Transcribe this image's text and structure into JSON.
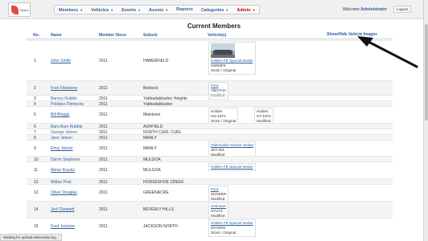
{
  "logo_text": "Demo",
  "nav": [
    {
      "label": "Members",
      "caret": true
    },
    {
      "label": "Vehicles",
      "caret": true
    },
    {
      "label": "Events",
      "caret": true
    },
    {
      "label": "Assets",
      "caret": true
    },
    {
      "label": "Reports",
      "caret": false
    },
    {
      "label": "Categories",
      "caret": true
    },
    {
      "label": "Admin",
      "caret": true,
      "highlight": true
    }
  ],
  "welcome_text": "Welcome",
  "welcome_user": "Administrator",
  "logout_label": "Logout",
  "page_title": "Current Members",
  "toggle_images_label": "Show/Hide Vehicle Images",
  "columns": {
    "no": "No.",
    "name": "Name",
    "since": "Member Since",
    "suburb": "Suburb",
    "vehicles": "Vehicle(s)"
  },
  "members": [
    {
      "no": "1",
      "name": "John Smith",
      "since": "2011",
      "suburb": "HABERFIELD",
      "vehicles": [
        {
          "name": "Holden FE Special Sedan",
          "plate": "GMS6FE",
          "status": "Stock / Original",
          "image": true
        }
      ]
    },
    {
      "no": "2",
      "name": "Fred Flintstone",
      "since": "2011",
      "suburb": "Bedrock",
      "vehicles": [
        {
          "name": "Ford",
          "plate": "YBOTHA",
          "status": "Modified"
        }
      ]
    },
    {
      "no": "3",
      "name": "Barney Rubble",
      "since": "2011",
      "suburb": "Yabbadabbadoo Heights",
      "vehicles": []
    },
    {
      "no": "4",
      "name": "Pebbles Flintstone",
      "since": "2011",
      "suburb": "Yabbadabbadoo",
      "vehicles": []
    },
    {
      "no": "5",
      "name": "Bill Bloggs",
      "since": "2011",
      "suburb": "Maintown",
      "vehicles": [
        {
          "name": "Holden",
          "plate": "HG-1971",
          "status": "Stock / Original",
          "plain": true
        },
        {
          "name": "Holden",
          "plate": "HT-1970",
          "status": "Modified",
          "plain": true
        }
      ]
    },
    {
      "no": "6",
      "name": "Bam-Bam Rubble",
      "since": "2011",
      "suburb": "ASHFIELD",
      "vehicles": []
    },
    {
      "no": "7",
      "name": "George Jetson",
      "since": "2011",
      "suburb": "NORTH CURL CURL",
      "vehicles": []
    },
    {
      "no": "8",
      "name": "Jane Jetson",
      "since": "2011",
      "suburb": "MANLY",
      "vehicles": []
    },
    {
      "no": "9",
      "name": "Elroy Jetson",
      "since": "2011",
      "suburb": "MANLY",
      "vehicles": [
        {
          "name": "Oldsmobile Rocket Sedan",
          "plate": "JET-001",
          "status": "Modified"
        }
      ]
    },
    {
      "no": "10",
      "name": "Darrin Stephens",
      "since": "2011",
      "suburb": "MULGOA",
      "vehicles": []
    },
    {
      "no": "11",
      "name": "Abner Kravitz",
      "since": "2011",
      "suburb": "MULGOA",
      "vehicles": [
        {
          "name": "Holden FE Special Sedan",
          "plate": "",
          "status": ""
        }
      ]
    },
    {
      "no": "12",
      "name": "Wilbur Post",
      "since": "2011",
      "suburb": "HORSESHOE CREEK",
      "vehicles": []
    },
    {
      "no": "13",
      "name": "Oliver Douglas",
      "since": "2011",
      "suburb": "GREENACRE",
      "vehicles": [
        {
          "name": "Ford",
          "plate": "SUNKER",
          "status": "Modified"
        }
      ]
    },
    {
      "no": "14",
      "name": "Jed Clampett",
      "since": "2011",
      "suburb": "BEVERLY HILLS",
      "vehicles": [
        {
          "name": "Unknown",
          "plate": "STUTZ",
          "status": "Modified"
        }
      ]
    },
    {
      "no": "15",
      "name": "Fred Jackson",
      "since": "2011",
      "suburb": "JACKSON NORTH",
      "vehicles": [
        {
          "name": "Holden FE Special Sedan",
          "plate": "MYS6FE",
          "status": "Stock / Original"
        }
      ]
    }
  ],
  "status_bar": "Waiting for upload.wikimedia.org..."
}
